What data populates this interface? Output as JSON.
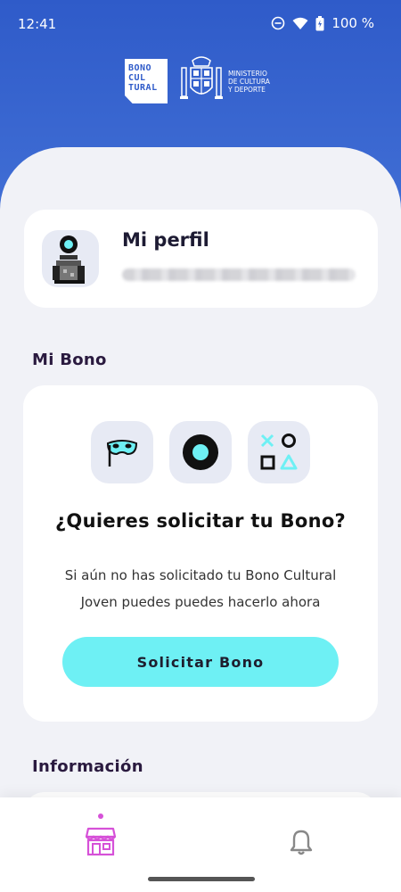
{
  "status_bar": {
    "time": "12:41",
    "battery": "100 %"
  },
  "header": {
    "bono_logo_lines": [
      "BONO",
      "CUL",
      "TURAL"
    ],
    "ministry_lines": [
      "MINISTERIO",
      "DE CULTURA",
      "Y DEPORTE"
    ]
  },
  "profile": {
    "title": "Mi perfil"
  },
  "bono_section": {
    "heading": "Mi Bono",
    "icons": [
      "mask-icon",
      "ring-icon",
      "game-symbols-icon"
    ],
    "question": "¿Quieres solicitar tu Bono?",
    "description": "Si aún no has solicitado tu Bono Cultural Joven puedes puedes hacerlo ahora",
    "button_label": "Solicitar Bono"
  },
  "info_section": {
    "heading": "Información"
  },
  "bottom_nav": {
    "items": [
      "store-icon",
      "bell-icon"
    ],
    "active": "store-icon"
  },
  "colors": {
    "header_blue": "#3762c9",
    "accent_cyan": "#6ef0f4",
    "active_nav": "#d651d8",
    "sheet_bg": "#f1f2f7"
  }
}
